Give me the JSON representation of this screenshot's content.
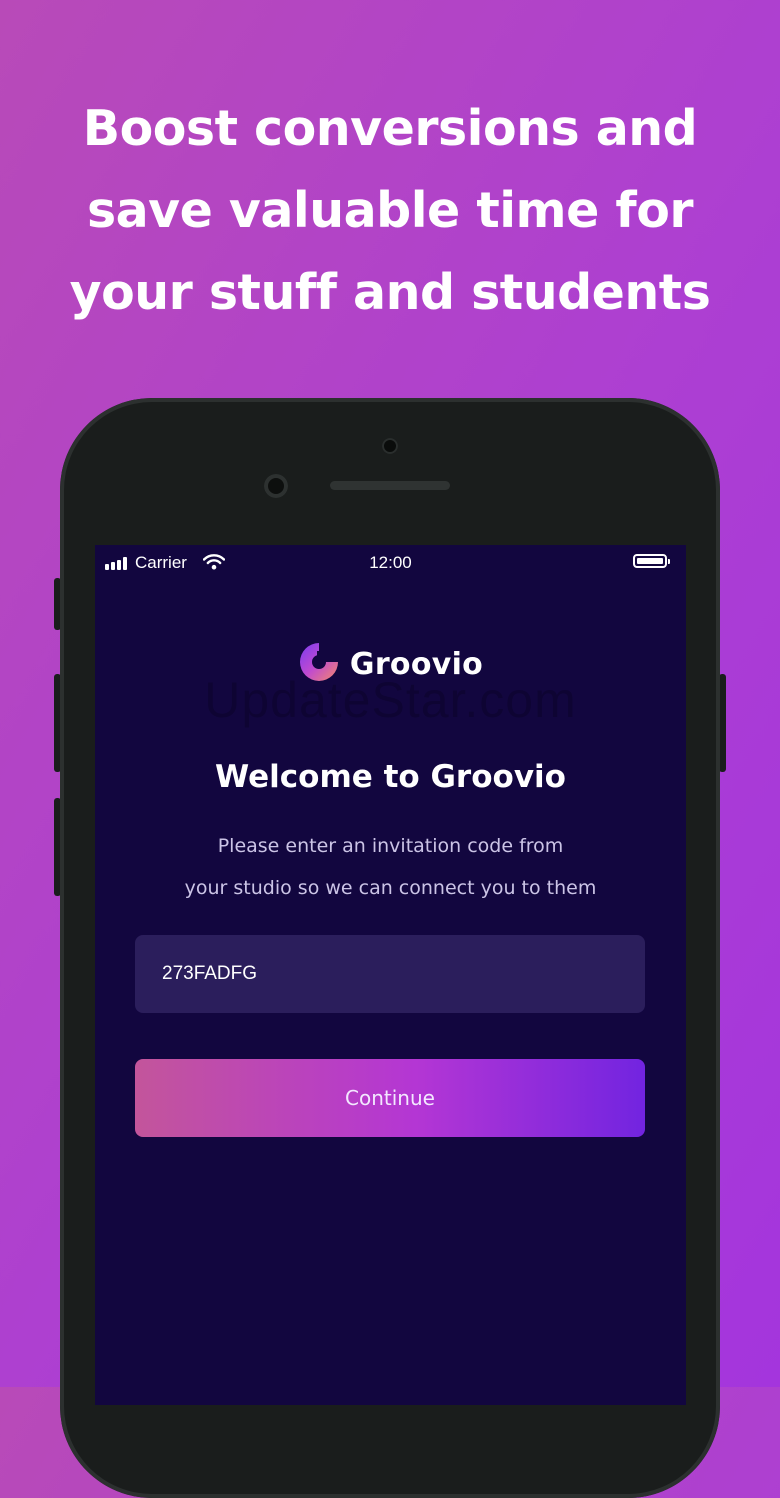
{
  "headline": {
    "line1": "Boost conversions and",
    "line2": "save valuable time for",
    "line3": "your stuff and students"
  },
  "status_bar": {
    "carrier": "Carrier",
    "time": "12:00"
  },
  "app": {
    "brand_name": "Groovio",
    "watermark": "UpdateStar.com",
    "welcome_title": "Welcome to Groovio",
    "subtitle_line1": "Please enter an invitation code from",
    "subtitle_line2": "your studio so we can connect you to them",
    "invitation_code_value": "273FADFG",
    "continue_label": "Continue"
  },
  "colors": {
    "background_purple": "#ad3fd2",
    "screen_navy": "#12063f",
    "field_bg": "#2b1e5c",
    "button_gradient_start": "#c3559b",
    "button_gradient_end": "#7224e0"
  },
  "icons": [
    "signal-icon",
    "wifi-icon",
    "battery-icon",
    "groovio-logo-icon"
  ]
}
